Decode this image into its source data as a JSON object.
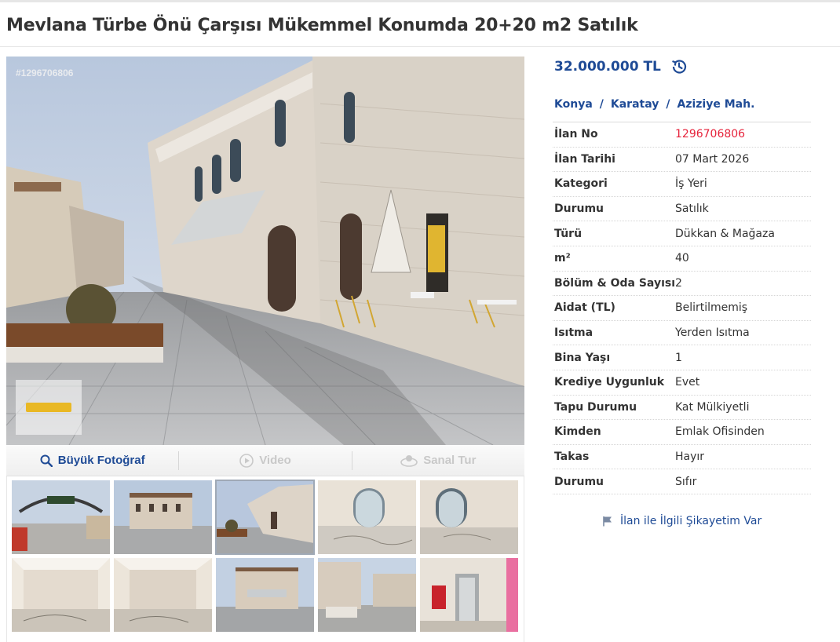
{
  "listing": {
    "title": "Mevlana Türbe Önü Çarşısı Mükemmel Konumda 20+20 m2 Satılık",
    "photo_id": "#1296706806",
    "price": "32.000.000 TL",
    "location": {
      "city": "Konya",
      "district": "Karatay",
      "neighborhood": "Aziziye Mah.",
      "separator": "/"
    }
  },
  "gallery": {
    "toolbar": {
      "photo_label": "Büyük Fotoğraf",
      "video_label": "Video",
      "tour_label": "Sanal Tur"
    },
    "selected_index": 2,
    "thumb_count": 10
  },
  "details": [
    {
      "key": "İlan No",
      "value": "1296706806"
    },
    {
      "key": "İlan Tarihi",
      "value": "07 Mart 2026"
    },
    {
      "key": "Kategori",
      "value": "İş Yeri"
    },
    {
      "key": "Durumu",
      "value": "Satılık"
    },
    {
      "key": "Türü",
      "value": "Dükkan & Mağaza"
    },
    {
      "key": "m²",
      "value": "40"
    },
    {
      "key": "Bölüm & Oda Sayısı",
      "value": "2"
    },
    {
      "key": "Aidat (TL)",
      "value": "Belirtilmemiş"
    },
    {
      "key": "Isıtma",
      "value": "Yerden Isıtma"
    },
    {
      "key": "Bina Yaşı",
      "value": "1"
    },
    {
      "key": "Krediye Uygunluk",
      "value": "Evet"
    },
    {
      "key": "Tapu Durumu",
      "value": "Kat Mülkiyetli"
    },
    {
      "key": "Kimden",
      "value": "Emlak Ofisinden"
    },
    {
      "key": "Takas",
      "value": "Hayır"
    },
    {
      "key": "Durumu",
      "value": "Sıfır"
    }
  ],
  "complaint_label": "İlan ile İlgili Şikayetim Var",
  "colors": {
    "accent": "#1f4b96",
    "listing_number": "#e6233b",
    "text": "#333333"
  },
  "icons": {
    "price_history": "history-icon",
    "photo": "search-icon",
    "video": "play-circle-icon",
    "tour": "panorama-icon",
    "complaint": "flag-icon"
  }
}
